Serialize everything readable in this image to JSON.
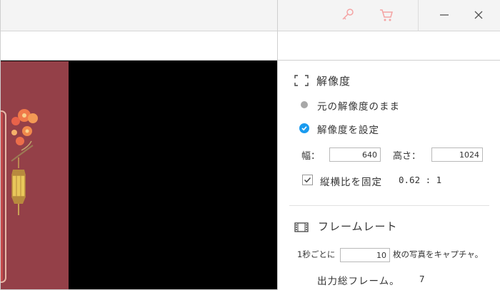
{
  "window": {
    "icons": [
      "key-icon",
      "cart-icon",
      "minimize-icon",
      "close-icon"
    ],
    "accent_icon_color": "#f4a3a3"
  },
  "resolution": {
    "title": "解像度",
    "option_keep": "元の解像度のまま",
    "option_set": "解像度を設定",
    "selected": "option_set",
    "width_label": "幅：",
    "width_value": "640",
    "height_label": "高さ：",
    "height_value": "1024",
    "lock_ratio_label": "縦横比を固定",
    "lock_ratio_checked": true,
    "ratio_value": "0.62 : 1"
  },
  "framerate": {
    "title": "フレームレート",
    "prefix": "1秒ごとに",
    "interval_value": "10",
    "suffix": "枚の写真をキャプチャ。",
    "total_label": "出力総フレーム。",
    "total_value": "7"
  },
  "colors": {
    "accent_blue": "#1a9bef",
    "radio_gray": "#a8a8a8",
    "poster_bg": "#944048"
  }
}
